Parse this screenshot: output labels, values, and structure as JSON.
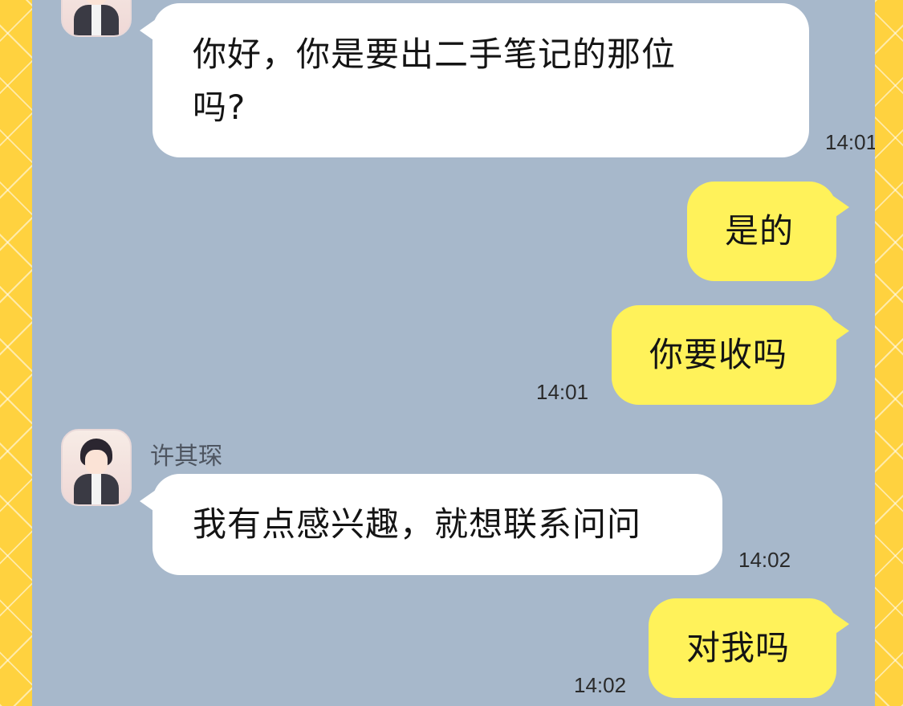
{
  "messages": [
    {
      "side": "in",
      "text_line1": "你好，你是要出二手笔记的那位",
      "text_line2": "吗?",
      "time": "14:01"
    },
    {
      "side": "out",
      "text": "是的",
      "time": ""
    },
    {
      "side": "out",
      "text": "你要收吗",
      "time": "14:01"
    },
    {
      "side": "in",
      "sender": "许其琛",
      "text": "我有点感兴趣，就想联系问问",
      "time": "14:02"
    },
    {
      "side": "out",
      "text": "对我吗",
      "time": "14:02"
    }
  ]
}
